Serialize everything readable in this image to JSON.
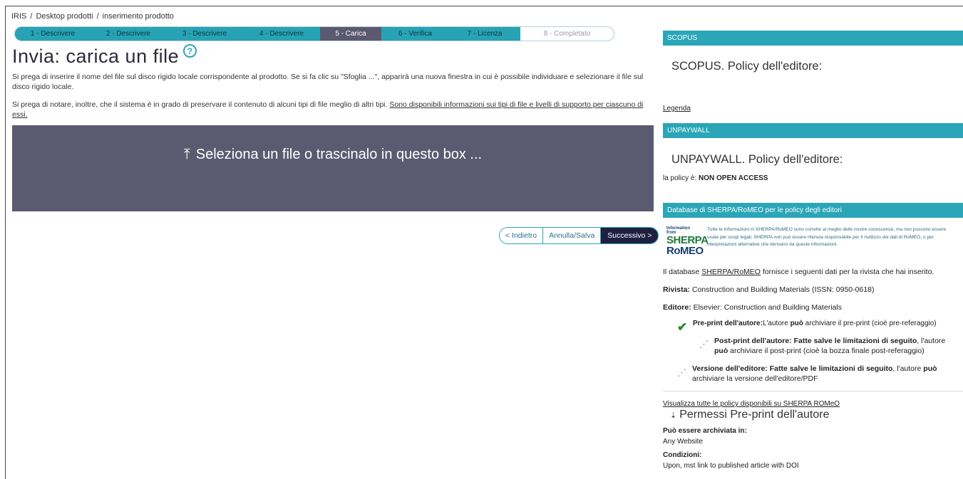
{
  "breadcrumb": {
    "root": "IRIS",
    "sep1": "/",
    "desk": "Desktop prodotti",
    "sep2": "/",
    "current": "inserimento prodotto"
  },
  "steps": [
    {
      "label": "1 - Descrivere",
      "state": "done"
    },
    {
      "label": "2 - Descrivere",
      "state": "done"
    },
    {
      "label": "3 - Descrivere",
      "state": "done"
    },
    {
      "label": "4 - Descrivere",
      "state": "done"
    },
    {
      "label": "5 - Carica",
      "state": "active"
    },
    {
      "label": "6 - Verifica",
      "state": "todo"
    },
    {
      "label": "7 - Licenza",
      "state": "todo"
    },
    {
      "label": "8 - Completato",
      "state": "disabled"
    }
  ],
  "main": {
    "title": "Invia: carica un file",
    "help_icon": "?",
    "para1": "Si prega di inserire il nome del file sul disco rigido locale corrispondente al prodotto. Se si fa clic su \"Sfoglia ...\", apparirà una nuova finestra in cui è possibile individuare e selezionare il file sul disco rigido locale.",
    "para2_text": "Si prega di notare, inoltre, che il sistema è in grado di preservare il contenuto di alcuni tipi di file meglio di altri tipi.",
    "para2_link": "Sono disponibili informazioni sui tipi di file e livelli di supporto per ciascuno di essi.",
    "dropzone_label": "Seleziona un file o trascinalo in questo box ...",
    "buttons": {
      "back": "< Indietro",
      "save": "Annulla/Salva",
      "next": "Successivo >"
    }
  },
  "scopus": {
    "header": "SCOPUS",
    "title": "SCOPUS. Policy dell'editore:",
    "legend_link": "Legenda"
  },
  "unpaywall": {
    "header": "UNPAYWALL",
    "title": "UNPAYWALL. Policy dell'editore:",
    "policy_prefix": "la policy è:",
    "policy_value": "NON OPEN ACCESS"
  },
  "sherpa": {
    "header": "Database di SHERPA/RoMEO per le policy degli editori",
    "logo_line1": "Information from",
    "logo_line2": "SHERPA",
    "logo_line3": "RoMEO",
    "note": "Tutte le informazioni in SHERPA/RoMEO sono corrette al meglio delle nostre conoscenze, ma non possono essere usate per scopi legali. SHERPA non può essere ritenuta responsabile per il riutilizzo dei dati di RoMEO, o per interpretazioni alternative che derivano da queste informazioni.",
    "db_prefix": "Il database",
    "db_link": "SHERPA/RoMEO",
    "db_suffix": "fornisce i seguenti dati per la rivista che hai inserito.",
    "journal_label": "Rivista:",
    "journal_value": "Construction and Building Materials (ISSN: 0950-0618)",
    "publisher_label": "Editore:",
    "publisher_value": "Elsevier: Construction and Building Materials",
    "preprint_bold": "Pre-print dell'autore:",
    "preprint_text1": "L'autore",
    "preprint_can": "può",
    "preprint_text2": "archiviare il pre-print (cioè pre-referaggio)",
    "postprint_bold": "Post-print dell'autore: Fatte salve le limitazioni di seguito",
    "postprint_text1": ", l'autore",
    "postprint_can": "può",
    "postprint_text2": "archiviare il post-print (cioè la bozza finale post-referaggio)",
    "version_bold": "Versione dell'editore: Fatte salve le limitazioni di seguito",
    "version_text1": ", l'autore",
    "version_can": "può",
    "version_text2": "archiviare la versione dell'editore/PDF",
    "all_policies_link": "Visualizza tutte le policy disponibili su SHERPA ROMeO",
    "section_title": "Permessi Pre-print dell'autore",
    "archived_label": "Può essere archiviata in:",
    "archived_value": "Any Website",
    "conditions_label": "Condizioni:",
    "conditions_value": "Upon, mst link to published article with DOI"
  }
}
